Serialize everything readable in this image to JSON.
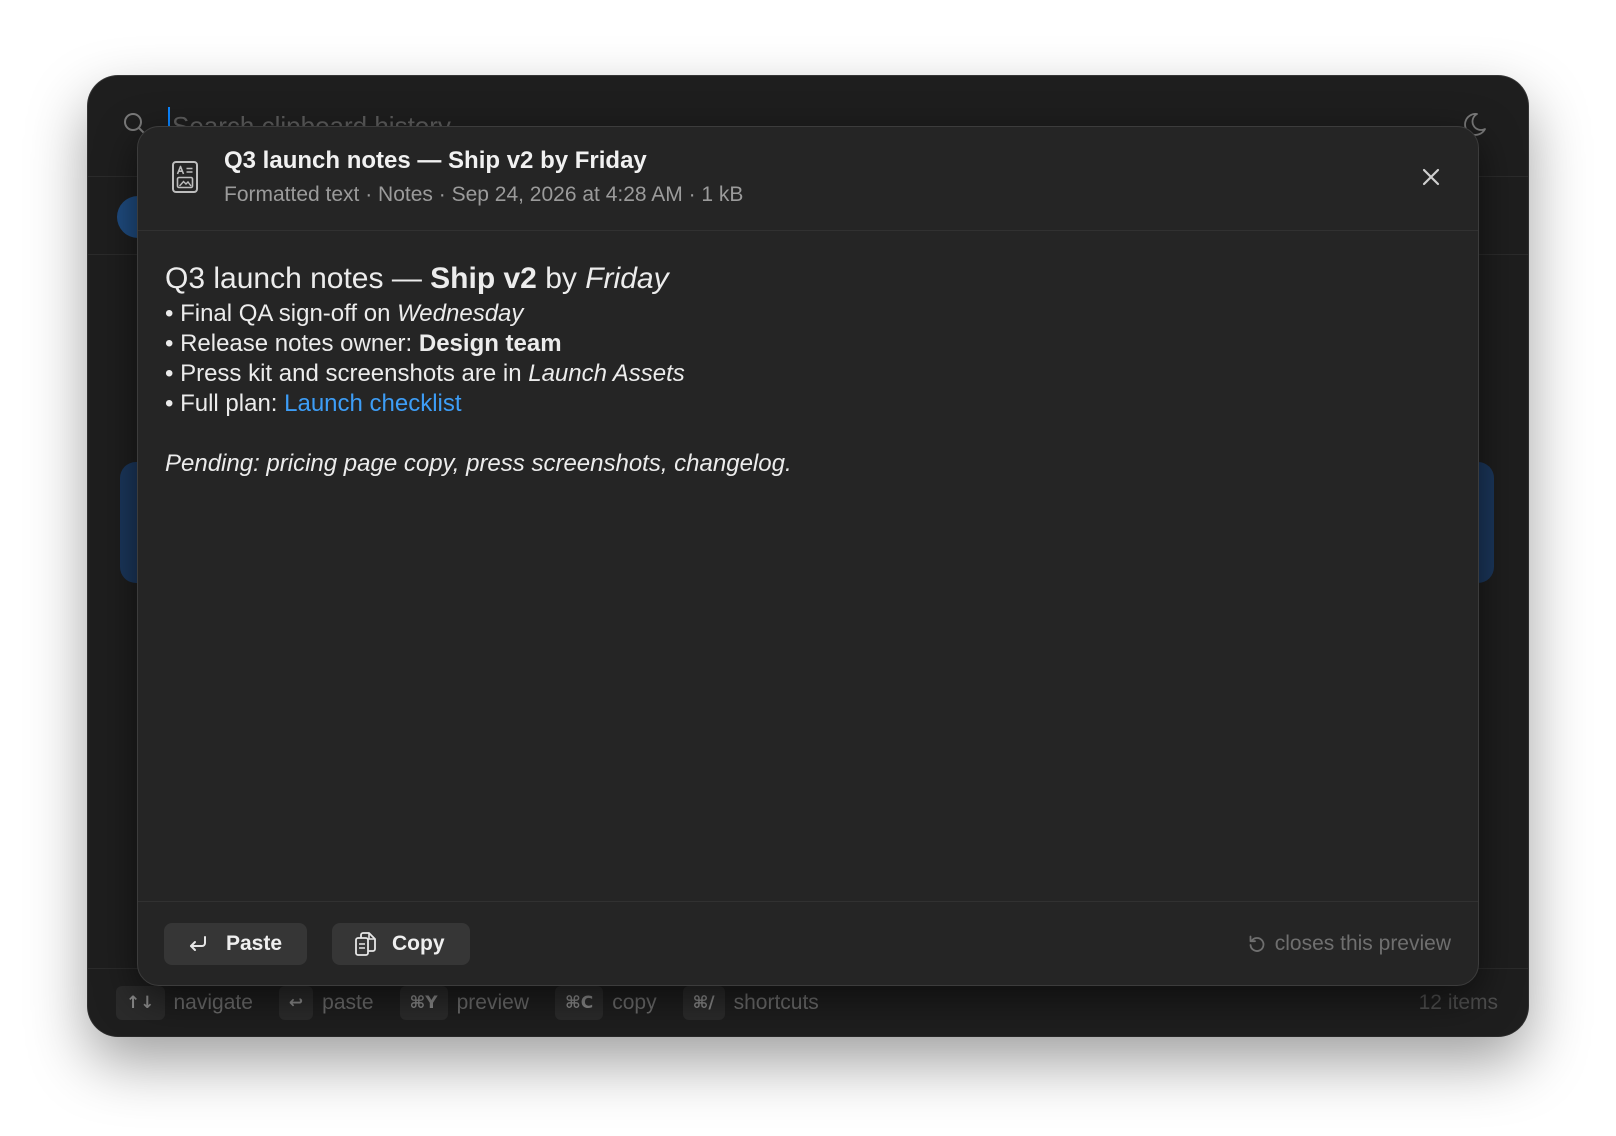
{
  "theme": {
    "accent": "#0a84ff",
    "link": "#3d9df6"
  },
  "search": {
    "placeholder": "Search clipboard history",
    "icon": "search-icon",
    "mode_icon": "moon-icon"
  },
  "preview": {
    "icon": "rich-text-icon",
    "title": "Q3 launch notes — Ship v2 by Friday",
    "meta": "Formatted text · Notes · Sep 24, 2026 at 4:28 AM · 1 kB",
    "close_icon": "close-icon",
    "body": {
      "heading": {
        "text_1": "Q3 launch notes — ",
        "bold": "Ship v2",
        "text_2": " by ",
        "italic": "Friday"
      },
      "lines": [
        {
          "text": "• Final QA sign-off on ",
          "italic": "Wednesday"
        },
        {
          "text": "• Release notes owner: ",
          "bold": "Design team"
        },
        {
          "text": "• Press kit and screenshots are in ",
          "italic": "Launch Assets"
        },
        {
          "text": "• Full plan: ",
          "link": "Launch checklist"
        }
      ],
      "note": "Pending: pricing page copy, press screenshots, changelog."
    },
    "actions": [
      {
        "label": "Paste",
        "icon": "return-icon"
      },
      {
        "label": "Copy",
        "icon": "copy-icon"
      }
    ],
    "hint": {
      "icon": "reset-icon",
      "text": "closes this preview"
    }
  },
  "footer": {
    "shortcuts": [
      {
        "key": "↑↓",
        "label": "navigate"
      },
      {
        "key": "↩",
        "label": "paste"
      },
      {
        "key": "⌘Y",
        "label": "preview"
      },
      {
        "key": "⌘C",
        "label": "copy"
      },
      {
        "key": "⌘/",
        "label": "shortcuts"
      }
    ],
    "count": "12 items"
  }
}
